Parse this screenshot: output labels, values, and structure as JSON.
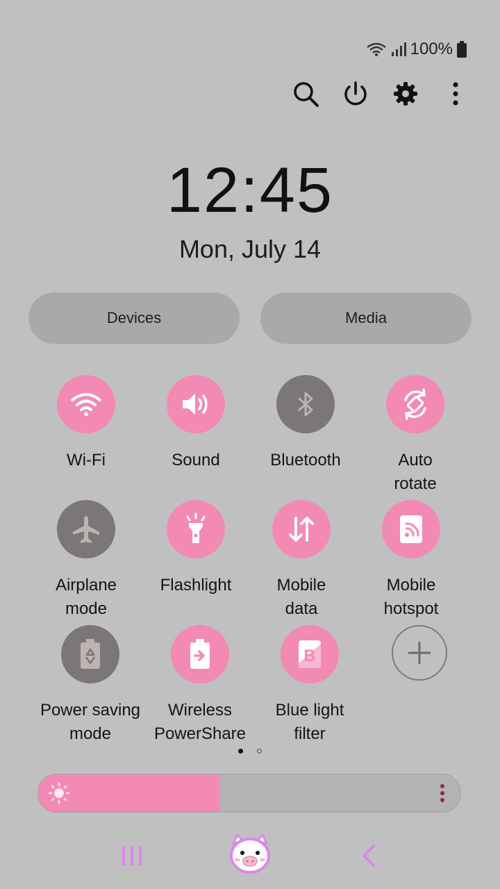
{
  "status_bar": {
    "battery_text": "100%",
    "icons": [
      "wifi-icon",
      "signal-icon",
      "battery-icon"
    ]
  },
  "top_actions": [
    "search-icon",
    "power-icon",
    "settings-icon",
    "more-options-icon"
  ],
  "clock": {
    "time": "12:45",
    "date": "Mon, July 14"
  },
  "buttons": {
    "devices": "Devices",
    "media": "Media"
  },
  "tiles": [
    {
      "label": "Wi-Fi",
      "icon": "wifi-icon",
      "state": "on"
    },
    {
      "label": "Sound",
      "icon": "sound-icon",
      "state": "on"
    },
    {
      "label": "Bluetooth",
      "icon": "bluetooth-icon",
      "state": "off"
    },
    {
      "label": "Auto\nrotate",
      "icon": "auto-rotate-icon",
      "state": "on"
    },
    {
      "label": "Airplane\nmode",
      "icon": "airplane-icon",
      "state": "off"
    },
    {
      "label": "Flashlight",
      "icon": "flashlight-icon",
      "state": "on"
    },
    {
      "label": "Mobile\ndata",
      "icon": "mobile-data-icon",
      "state": "on"
    },
    {
      "label": "Mobile\nhotspot",
      "icon": "hotspot-icon",
      "state": "on"
    },
    {
      "label": "Power saving\nmode",
      "icon": "power-saving-icon",
      "state": "off"
    },
    {
      "label": "Wireless\nPowerShare",
      "icon": "wireless-powershare-icon",
      "state": "on"
    },
    {
      "label": "Blue light\nfilter",
      "icon": "blue-light-filter-icon",
      "state": "on"
    },
    {
      "label": "",
      "icon": "add-tile-icon",
      "state": "add"
    }
  ],
  "pager": {
    "pages": 2,
    "current": 1
  },
  "brightness": {
    "level": 0.43,
    "icon": "brightness-icon",
    "menu_icon": "more-vertical-icon"
  },
  "nav_bar": [
    "recent-apps-icon",
    "home-pig-icon",
    "back-icon"
  ],
  "colors": {
    "background": "#c0c0c0",
    "accent": "#f28ab3",
    "tile_off": "#7c7777",
    "nav": "#d986ef"
  }
}
